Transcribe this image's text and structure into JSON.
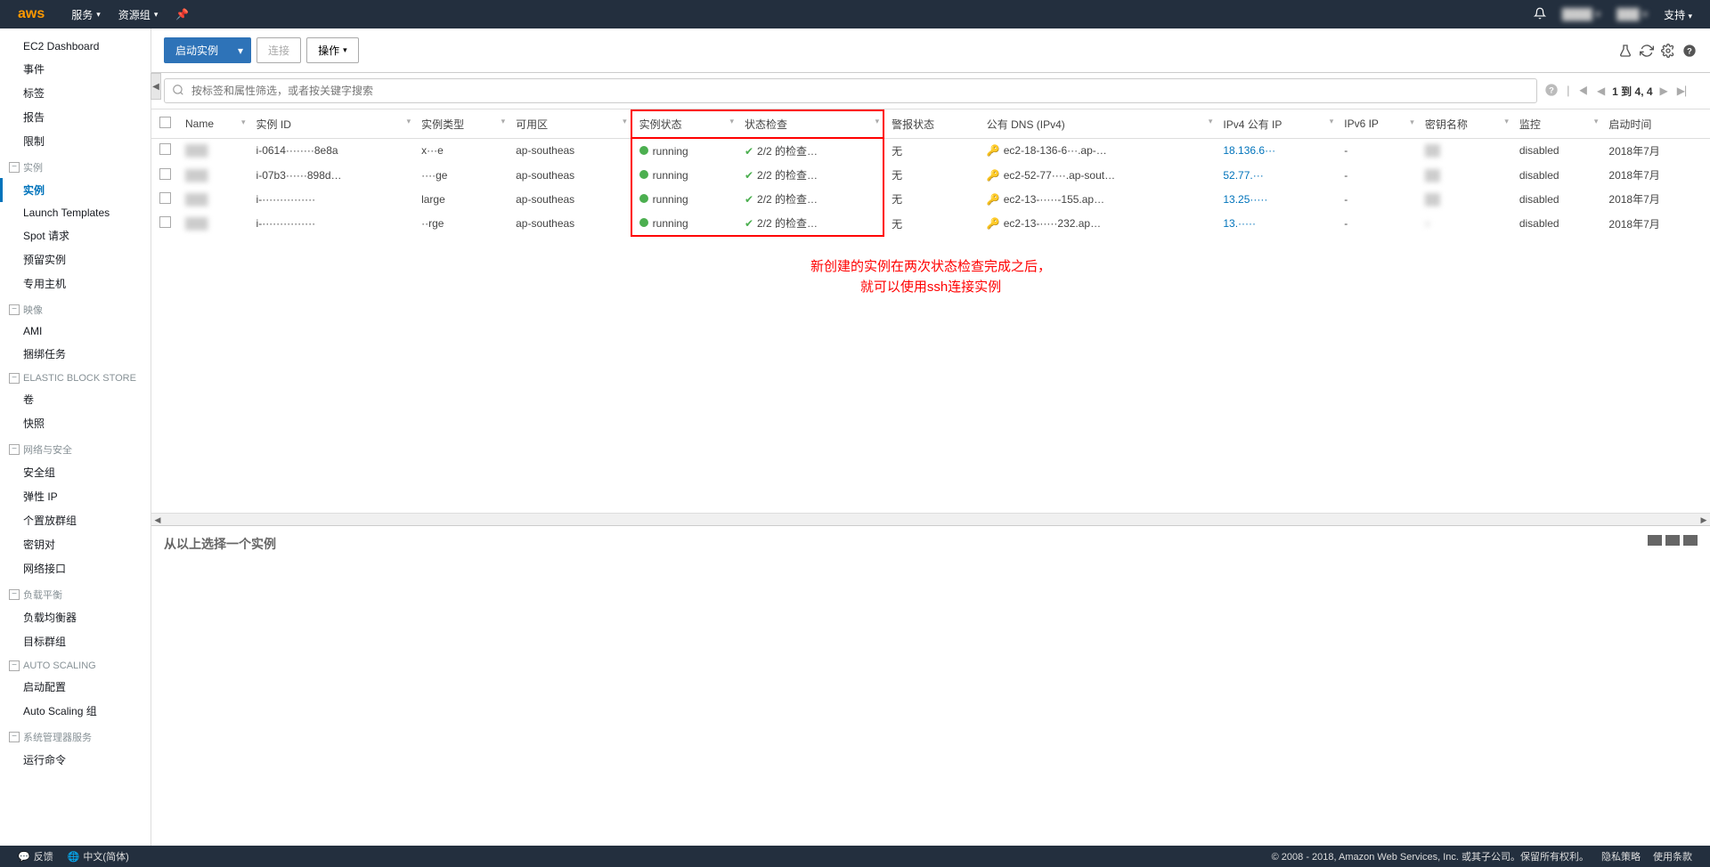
{
  "header": {
    "logo": "aws",
    "menu": [
      {
        "label": "服务",
        "hasDropdown": true
      },
      {
        "label": "资源组",
        "hasDropdown": true
      }
    ],
    "right": {
      "support": "支持"
    }
  },
  "sidebar": {
    "top": [
      {
        "label": "EC2 Dashboard"
      },
      {
        "label": "事件"
      },
      {
        "label": "标签"
      },
      {
        "label": "报告"
      },
      {
        "label": "限制"
      }
    ],
    "groups": [
      {
        "header": "实例",
        "items": [
          {
            "label": "实例",
            "active": true
          },
          {
            "label": "Launch Templates"
          },
          {
            "label": "Spot 请求"
          },
          {
            "label": "预留实例"
          },
          {
            "label": "专用主机"
          }
        ]
      },
      {
        "header": "映像",
        "items": [
          {
            "label": "AMI"
          },
          {
            "label": "捆绑任务"
          }
        ]
      },
      {
        "header": "ELASTIC BLOCK STORE",
        "items": [
          {
            "label": "卷"
          },
          {
            "label": "快照"
          }
        ]
      },
      {
        "header": "网络与安全",
        "items": [
          {
            "label": "安全组"
          },
          {
            "label": "弹性 IP"
          },
          {
            "label": "个置放群组"
          },
          {
            "label": "密钥对"
          },
          {
            "label": "网络接口"
          }
        ]
      },
      {
        "header": "负载平衡",
        "items": [
          {
            "label": "负载均衡器"
          },
          {
            "label": "目标群组"
          }
        ]
      },
      {
        "header": "AUTO SCALING",
        "items": [
          {
            "label": "启动配置"
          },
          {
            "label": "Auto Scaling 组"
          }
        ]
      },
      {
        "header": "系统管理器服务",
        "items": [
          {
            "label": "运行命令"
          }
        ]
      }
    ]
  },
  "toolbar": {
    "launch": "启动实例",
    "connect": "连接",
    "actions": "操作"
  },
  "search": {
    "placeholder": "按标签和属性筛选，或者按关键字搜索"
  },
  "pagination": {
    "text": "1 到 4,  4"
  },
  "table": {
    "headers": {
      "name": "Name",
      "instanceId": "实例 ID",
      "instanceType": "实例类型",
      "zone": "可用区",
      "state": "实例状态",
      "statusCheck": "状态检查",
      "alarmStatus": "警报状态",
      "publicDns": "公有 DNS (IPv4)",
      "publicIp": "IPv4 公有 IP",
      "ipv6": "IPv6 IP",
      "keyName": "密钥名称",
      "monitoring": "监控",
      "launchTime": "启动时间"
    },
    "rows": [
      {
        "name": "",
        "instanceId": "i-0614········8e8a",
        "instanceType": "x···e",
        "zone": "ap-southeas",
        "state": "running",
        "statusCheck": "2/2 的检查…",
        "alarmStatus": "无",
        "publicDns": "ec2-18-136-6···.ap-…",
        "publicIp": "18.136.6···",
        "ipv6": "-",
        "keyName": "",
        "monitoring": "disabled",
        "launchTime": "2018年7月"
      },
      {
        "name": "",
        "instanceId": "i-07b3······898d…",
        "instanceType": "····ge",
        "zone": "ap-southeas",
        "state": "running",
        "statusCheck": "2/2 的检查…",
        "alarmStatus": "无",
        "publicDns": "ec2-52-77····.ap-sout…",
        "publicIp": "52.77.···",
        "ipv6": "-",
        "keyName": "",
        "monitoring": "disabled",
        "launchTime": "2018年7月"
      },
      {
        "name": "",
        "instanceId": "i-···············",
        "instanceType": "large",
        "zone": "ap-southeas",
        "state": "running",
        "statusCheck": "2/2 的检查…",
        "alarmStatus": "无",
        "publicDns": "ec2-13-·····-155.ap…",
        "publicIp": "13.25·····",
        "ipv6": "-",
        "keyName": "",
        "monitoring": "disabled",
        "launchTime": "2018年7月"
      },
      {
        "name": "",
        "instanceId": "i-···············",
        "instanceType": "··rge",
        "zone": "ap-southeas",
        "state": "running",
        "statusCheck": "2/2 的检查…",
        "alarmStatus": "无",
        "publicDns": "ec2-13-·····232.ap…",
        "publicIp": "13.·····",
        "ipv6": "-",
        "keyName": "v",
        "monitoring": "disabled",
        "launchTime": "2018年7月"
      }
    ]
  },
  "annotation": {
    "line1": "新创建的实例在两次状态检查完成之后，",
    "line2": "就可以使用ssh连接实例"
  },
  "bottom": {
    "title": "从以上选择一个实例"
  },
  "footer": {
    "feedback": "反馈",
    "language": "中文(简体)",
    "copyright": "© 2008 - 2018, Amazon Web Services, Inc. 或其子公司。保留所有权利。",
    "privacy": "隐私策略",
    "terms": "使用条款"
  }
}
